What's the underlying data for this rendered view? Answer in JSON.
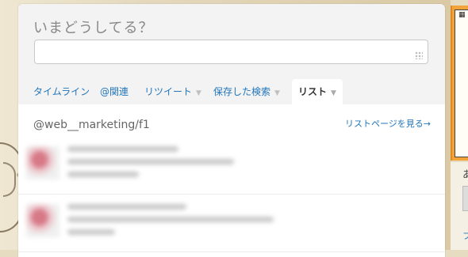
{
  "compose": {
    "title": "いまどうしてる？",
    "value": ""
  },
  "tabs": [
    {
      "label": "タイムライン",
      "caret": ""
    },
    {
      "label": "@関連",
      "caret": ""
    },
    {
      "label": "リツイート",
      "caret": "▼"
    },
    {
      "label": "保存した検索",
      "caret": "▼"
    },
    {
      "label": "リスト",
      "caret": "▼",
      "active": true
    }
  ],
  "list": {
    "name": "@web__marketing/f1",
    "page_link": "リストページを見る→"
  },
  "sidebar": {
    "fragment_char": "あ",
    "fragment_link": "フ"
  },
  "colors": {
    "link": "#2276bb",
    "accent_orange": "#f2a33a"
  }
}
